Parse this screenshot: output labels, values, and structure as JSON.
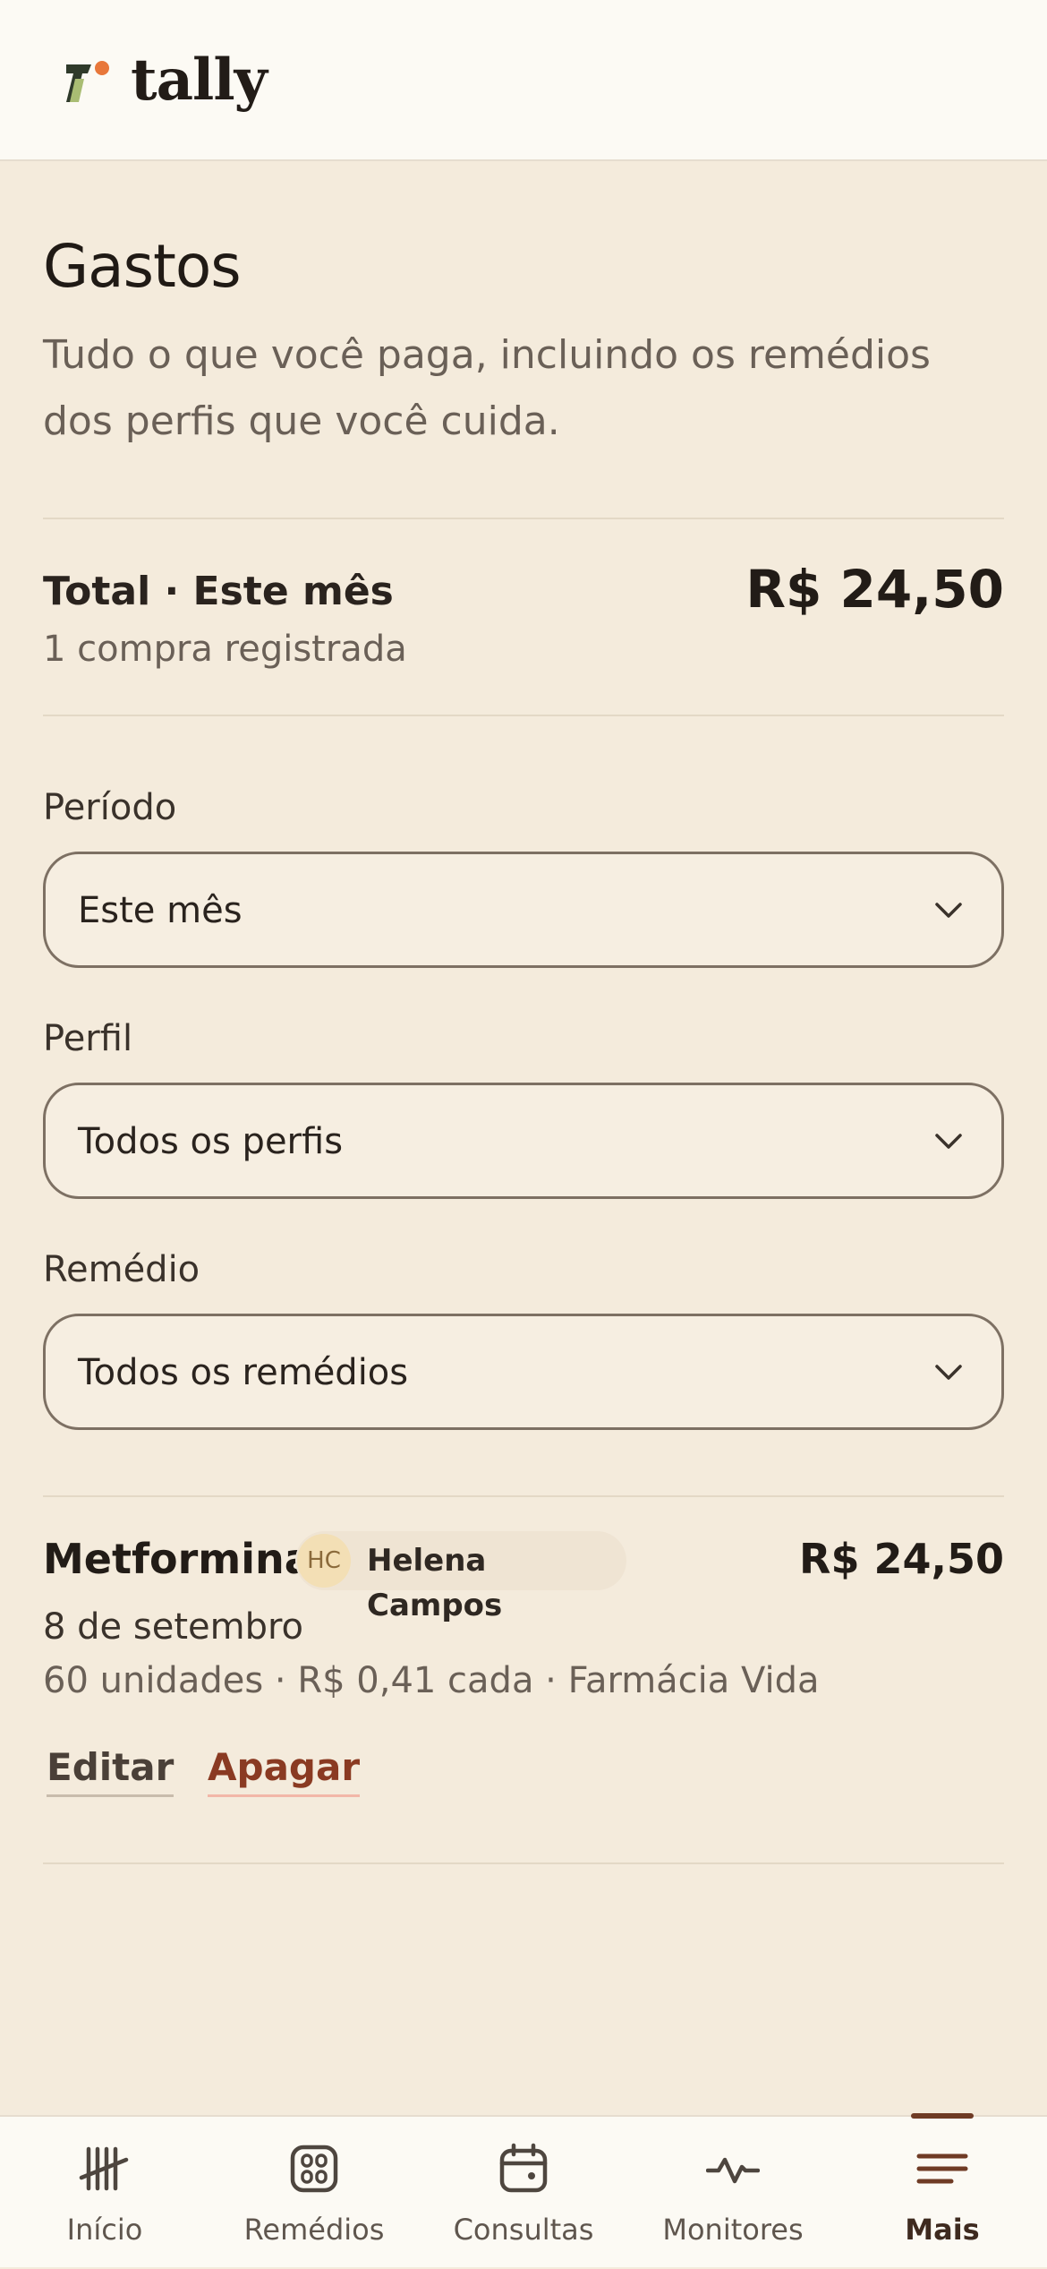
{
  "brand": {
    "name": "tally",
    "colors": {
      "dark": "#2f3a2a",
      "orange": "#e8773a",
      "green": "#a9bd73"
    }
  },
  "page": {
    "title": "Gastos",
    "subtitle": "Tudo o que você paga, incluindo os remédios dos perfis que você cuida."
  },
  "summary": {
    "label": "Total · Este mês",
    "count_text": "1 compra registrada",
    "total": "R$ 24,50"
  },
  "filters": {
    "period": {
      "label": "Período",
      "value": "Este mês"
    },
    "profile": {
      "label": "Perfil",
      "value": "Todos os perfis"
    },
    "medicine": {
      "label": "Remédio",
      "value": "Todos os remédios"
    }
  },
  "expenses": [
    {
      "medicine": "Metformina",
      "profile_initials": "HC",
      "profile_name": "Helena Campos",
      "price": "R$ 24,50",
      "date": "8 de setembro",
      "details": "60 unidades · R$ 0,41 cada · Farmácia Vida",
      "edit_label": "Editar",
      "delete_label": "Apagar"
    }
  ],
  "tabbar": {
    "active": "Mais",
    "accent": "#6f3b25",
    "items": [
      {
        "label": "Início",
        "icon": "tally-marks-icon"
      },
      {
        "label": "Remédios",
        "icon": "pill-box-icon"
      },
      {
        "label": "Consultas",
        "icon": "calendar-icon"
      },
      {
        "label": "Monitores",
        "icon": "pulse-icon"
      },
      {
        "label": "Mais",
        "icon": "menu-icon"
      }
    ]
  }
}
